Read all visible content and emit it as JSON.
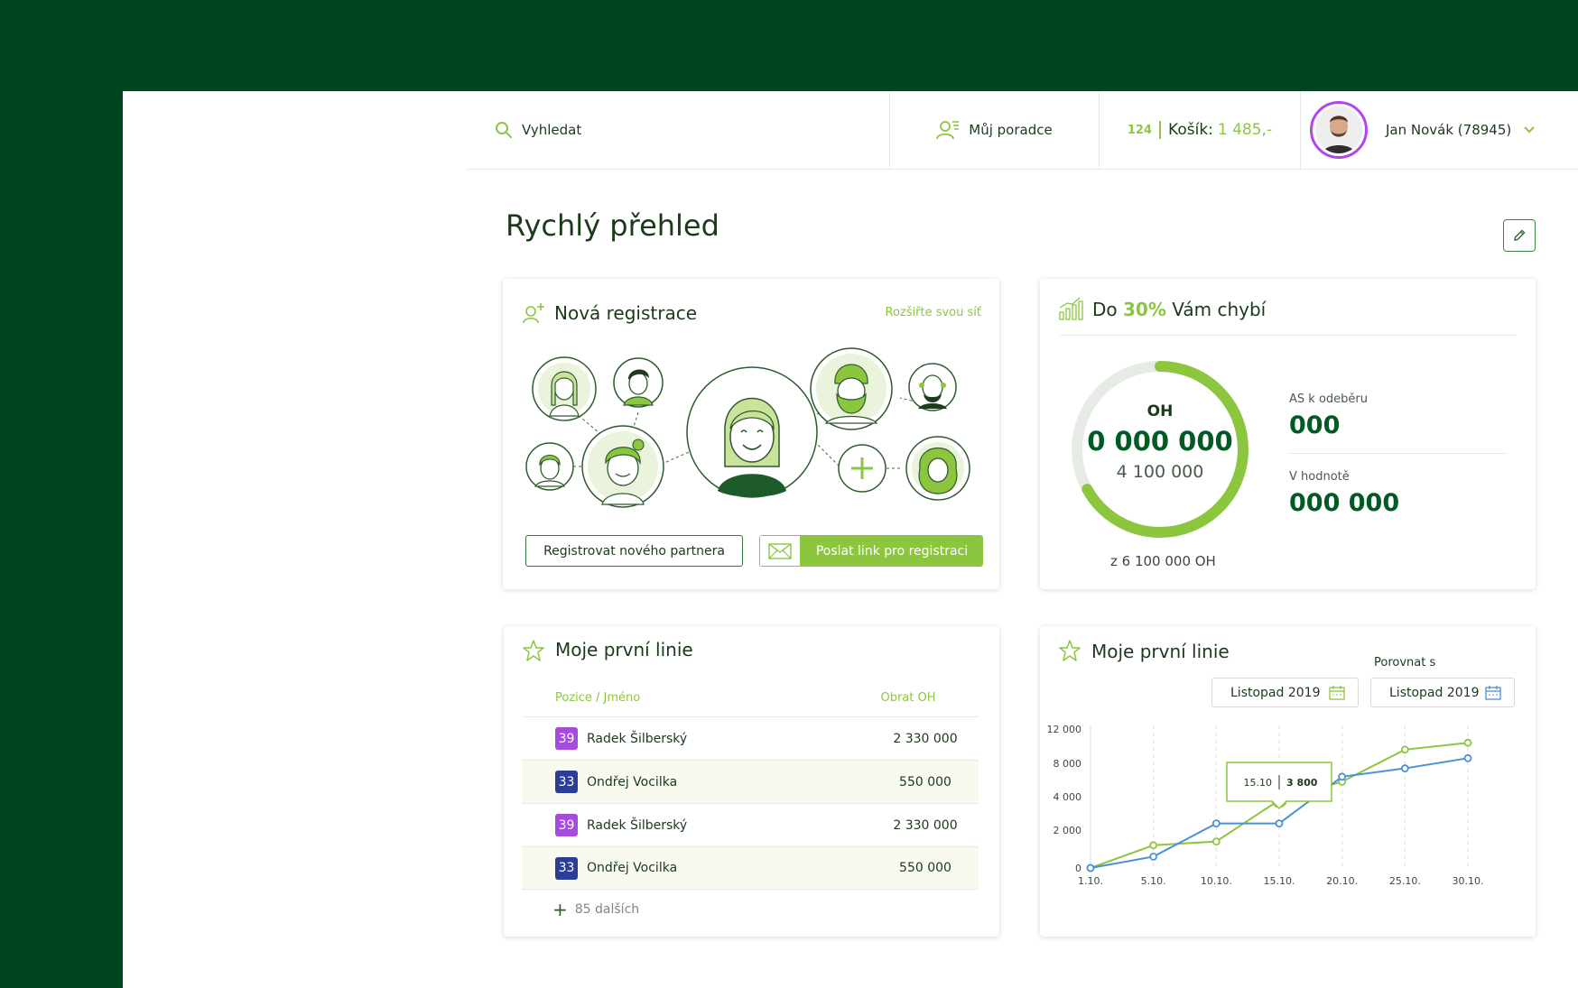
{
  "header": {
    "search_label": "Vyhledat",
    "advisor_label": "Můj poradce",
    "cart_count": "124",
    "cart_label": "Košík:",
    "cart_value": "1 485,-",
    "user_name": "Jan Novák (78945)"
  },
  "page": {
    "title": "Rychlý přehled"
  },
  "registration": {
    "title": "Nová registrace",
    "hint": "Rozšiřte svou síť",
    "register_button": "Registrovat nového partnera",
    "send_link_button": "Poslat link pro registraci"
  },
  "progress": {
    "title_prefix": "Do",
    "title_percent": "30%",
    "title_suffix": "Vám chybí",
    "center_label": "OH",
    "center_value": "0 000 000",
    "center_sub": "4 100 000",
    "total": "z 6 100 000 OH",
    "fill_fraction": 0.67,
    "stat1_label": "AS k odeběru",
    "stat1_value": "000",
    "stat2_label": "V hodnotě",
    "stat2_value": "000 000"
  },
  "first_line_table": {
    "title": "Moje první linie",
    "col_name": "Pozice / Jméno",
    "col_value": "Obrat OH",
    "rows": [
      {
        "pos": "39",
        "name": "Radek Šilberský",
        "value": "2 330 000",
        "color": "#a64be0"
      },
      {
        "pos": "33",
        "name": "Ondřej Vocilka",
        "value": "550 000",
        "color": "#2c3d98"
      },
      {
        "pos": "39",
        "name": "Radek Šilberský",
        "value": "2 330 000",
        "color": "#a64be0"
      },
      {
        "pos": "33",
        "name": "Ondřej Vocilka",
        "value": "550 000",
        "color": "#2c3d98"
      }
    ],
    "more": "85 dalších"
  },
  "first_line_chart": {
    "title": "Moje první linie",
    "compare_label": "Porovnat s",
    "date1": "Listopad 2019",
    "date2": "Listopad 2019",
    "tooltip_date": "15.10",
    "tooltip_value": "3 800"
  },
  "chart_data": {
    "type": "line",
    "x": [
      "1.10.",
      "5.10.",
      "10.10.",
      "15.10.",
      "20.10.",
      "25.10.",
      "30.10."
    ],
    "y_ticks": [
      "0",
      "2 000",
      "4 000",
      "8 000",
      "12 000"
    ],
    "series": [
      {
        "color": "#8cc63f",
        "values": [
          0,
          1200,
          1400,
          3800,
          5800,
          9600,
          10400
        ]
      },
      {
        "color": "#4a90d9",
        "values": [
          0,
          600,
          2400,
          2400,
          6400,
          7400,
          8600
        ]
      }
    ],
    "highlight": {
      "x": "15.10.",
      "value": 3800
    },
    "grid": "vertical dashed"
  }
}
